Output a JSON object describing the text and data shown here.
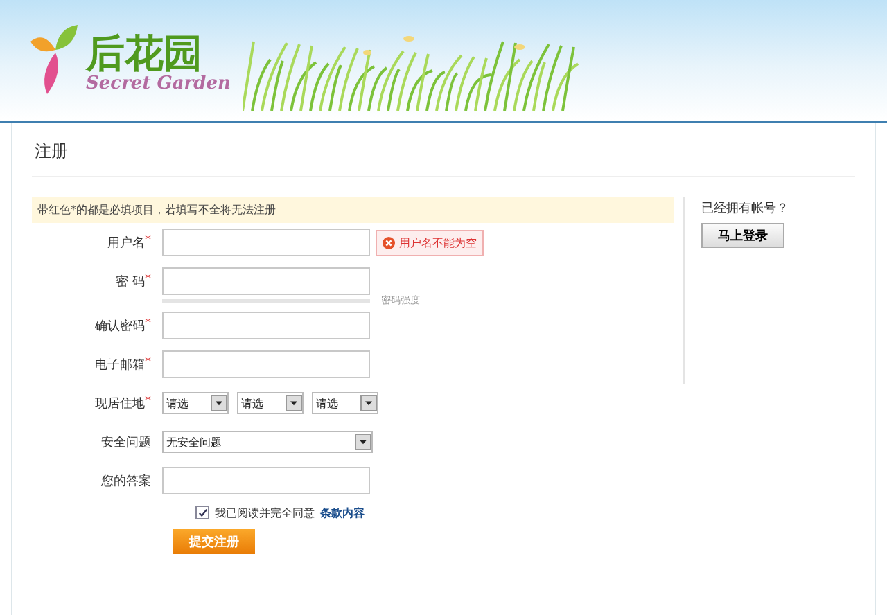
{
  "logo": {
    "title": "后花园",
    "subtitle": "Secret Garden"
  },
  "panel": {
    "title": "注册",
    "notice": "带红色*的都是必填项目，若填写不全将无法注册"
  },
  "fields": [
    {
      "kind": "text",
      "label": "用户名",
      "mark": "*",
      "error": "用户名不能为空"
    },
    {
      "kind": "password",
      "label": "密 码",
      "mark": "*",
      "strength": {
        "label": "密码强度",
        "level": 0
      }
    },
    {
      "kind": "password",
      "label": "确认密码",
      "mark": "*"
    },
    {
      "kind": "text",
      "label": "电子邮箱",
      "mark": "*"
    },
    {
      "kind": "selects",
      "label": "现居住地",
      "mark": "*",
      "options": [
        "请选",
        "请选",
        "请选"
      ]
    },
    {
      "kind": "select",
      "label": "安全问题",
      "value": "无安全问题"
    },
    {
      "kind": "text",
      "label": "您的答案"
    }
  ],
  "agreement": {
    "checked": true,
    "text": "我已阅读并完全同意",
    "link": "条款内容"
  },
  "submit": "提交注册",
  "login": {
    "prompt": "已经拥有帐号？",
    "button": "马上登录"
  }
}
